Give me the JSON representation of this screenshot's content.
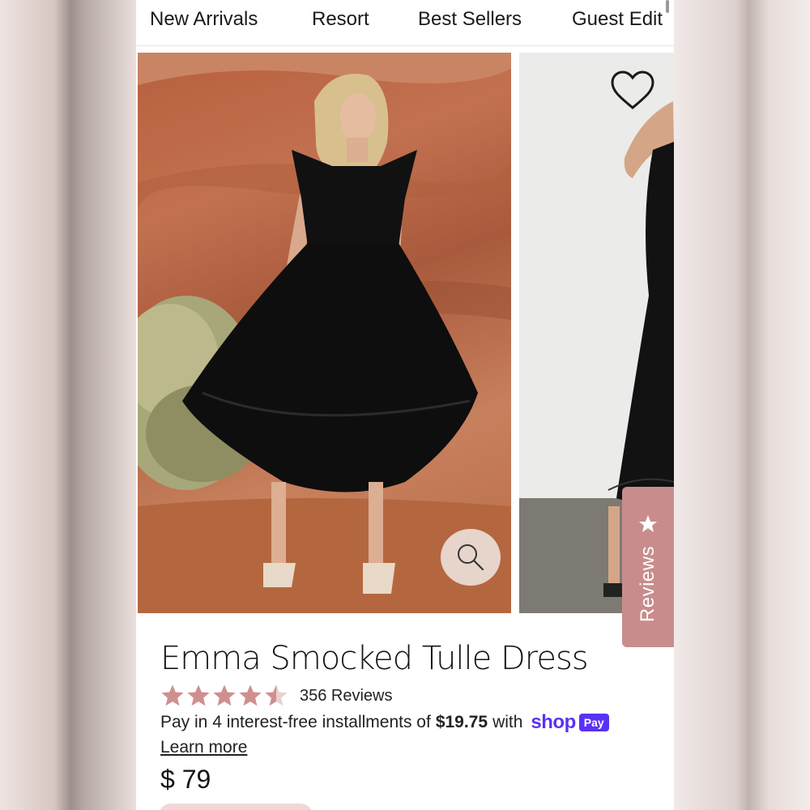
{
  "nav": {
    "items": [
      "New Arrivals",
      "Resort",
      "Best Sellers",
      "Guest Edit"
    ]
  },
  "gallery": {
    "main_image_alt": "",
    "second_image_alt": ""
  },
  "reviews_tab": {
    "label": "Reviews",
    "icon": "star-icon"
  },
  "product": {
    "title": "Emma Smocked Tulle Dress",
    "rating": 4.5,
    "review_count_text": "356 Reviews",
    "installment_prefix": "Pay in 4 interest-free installments of",
    "installment_amount": "$19.75",
    "installment_suffix": "with",
    "shop_logo_text": "shop",
    "pay_badge_text": "Pay",
    "learn_more": "Learn more",
    "price": "$ 79"
  },
  "colors": {
    "accent_pink": "#c98c8c",
    "star_color": "#d08f8f",
    "shop_purple": "#5a31f4"
  }
}
